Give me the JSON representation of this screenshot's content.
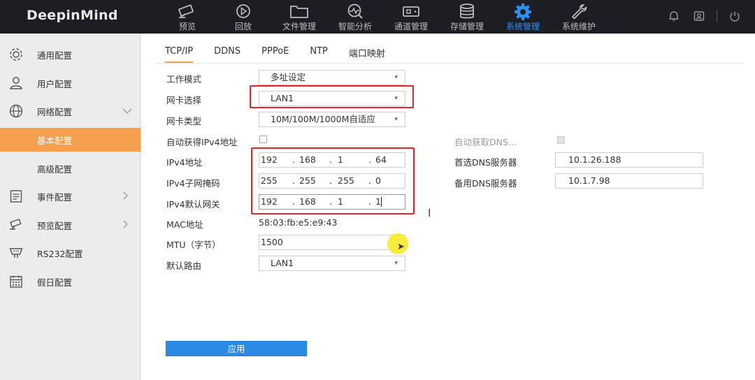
{
  "app": {
    "logo": "DeepinMind"
  },
  "nav": [
    {
      "label": "预览",
      "icon": "camera-icon"
    },
    {
      "label": "回放",
      "icon": "playback-icon"
    },
    {
      "label": "文件管理",
      "icon": "folder-icon"
    },
    {
      "label": "智能分析",
      "icon": "analysis-icon"
    },
    {
      "label": "通道管理",
      "icon": "channel-icon"
    },
    {
      "label": "存储管理",
      "icon": "storage-icon"
    },
    {
      "label": "系统管理",
      "icon": "gear-icon"
    },
    {
      "label": "系统维护",
      "icon": "wrench-icon"
    }
  ],
  "nav_active": "系统管理",
  "sidebar": {
    "items": [
      {
        "label": "通用配置",
        "icon": "gear-icon"
      },
      {
        "label": "用户配置",
        "icon": "user-icon"
      },
      {
        "label": "网络配置",
        "icon": "globe-icon",
        "arrow": "∨"
      },
      {
        "label": "基本配置"
      },
      {
        "label": "高级配置"
      },
      {
        "label": "事件配置",
        "icon": "event-icon",
        "arrow": ">"
      },
      {
        "label": "预览配置",
        "icon": "preview-icon",
        "arrow": ">"
      },
      {
        "label": "RS232配置",
        "icon": "rs232-icon"
      },
      {
        "label": "假日配置",
        "icon": "calendar-icon"
      }
    ]
  },
  "tabs": [
    "TCP/IP",
    "DDNS",
    "PPPoE",
    "NTP",
    "端口映射"
  ],
  "form": {
    "work_mode": {
      "label": "工作模式",
      "value": "多址设定"
    },
    "nic_select": {
      "label": "网卡选择",
      "value": "LAN1"
    },
    "nic_type": {
      "label": "网卡类型",
      "value": "10M/100M/1000M自适应"
    },
    "dhcp": {
      "label": "自动获得IPv4地址"
    },
    "ipv4_address": {
      "label": "IPv4地址",
      "octets": [
        "192",
        "168",
        "1",
        "64"
      ]
    },
    "ipv4_mask": {
      "label": "IPv4子网掩码",
      "octets": [
        "255",
        "255",
        "255",
        "0"
      ]
    },
    "ipv4_gateway": {
      "label": "IPv4默认网关",
      "octets": [
        "192",
        "168",
        "1",
        "1"
      ]
    },
    "mac": {
      "label": "MAC地址",
      "value": "58:03:fb:e5:e9:43"
    },
    "mtu": {
      "label": "MTU（字节）",
      "value": "1500"
    },
    "default_route": {
      "label": "默认路由",
      "value": "LAN1"
    },
    "dns_auto": {
      "label": "自动获取DNS..."
    },
    "dns_primary": {
      "label": "首选DNS服务器",
      "value": "10.1.26.188"
    },
    "dns_secondary": {
      "label": "备用DNS服务器",
      "value": "10.1.7.98"
    },
    "dot": "."
  },
  "apply_label": "应用",
  "colors": {
    "accent": "#f5a04f",
    "primary": "#2a8ae6",
    "highlight": "#e0262d",
    "topbar": "#1d1e23"
  }
}
